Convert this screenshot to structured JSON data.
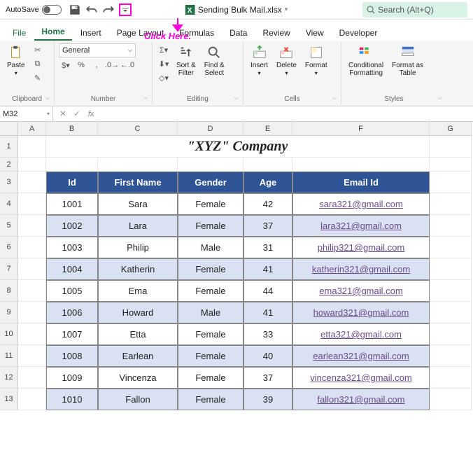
{
  "title": {
    "autosave": "AutoSave",
    "toggle": "Off",
    "filename": "Sending Bulk Mail.xlsx",
    "search": "Search (Alt+Q)"
  },
  "annotation": {
    "click": "Click Here."
  },
  "tabs": [
    "File",
    "Home",
    "Insert",
    "Page Layout",
    "Formulas",
    "Data",
    "Review",
    "View",
    "Developer"
  ],
  "ribbon": {
    "clipboard": "Clipboard",
    "paste": "Paste",
    "number": "Number",
    "numFormat": "General",
    "editing": "Editing",
    "sort": "Sort &\nFilter",
    "find": "Find &\nSelect",
    "cells": "Cells",
    "insert": "Insert",
    "delete": "Delete",
    "format": "Format",
    "styles": "Styles",
    "cond": "Conditional\nFormatting",
    "fmtTable": "Format as\nTable"
  },
  "fx": {
    "name": "M32"
  },
  "cols": [
    "A",
    "B",
    "C",
    "D",
    "E",
    "F",
    "G"
  ],
  "rows": [
    "1",
    "2",
    "3",
    "4",
    "5",
    "6",
    "7",
    "8",
    "9",
    "10",
    "11",
    "12",
    "13"
  ],
  "company": "\"XYZ\" Company",
  "headers": {
    "id": "Id",
    "fn": "First Name",
    "g": "Gender",
    "age": "Age",
    "email": "Email Id"
  },
  "data": [
    {
      "id": "1001",
      "fn": "Sara",
      "g": "Female",
      "age": "42",
      "email": "sara321@gmail.com"
    },
    {
      "id": "1002",
      "fn": "Lara",
      "g": "Female",
      "age": "37",
      "email": "lara321@gmail.com"
    },
    {
      "id": "1003",
      "fn": "Philip",
      "g": "Male",
      "age": "31",
      "email": "philip321@gmail.com"
    },
    {
      "id": "1004",
      "fn": "Katherin",
      "g": "Female",
      "age": "41",
      "email": "katherin321@gmail.com"
    },
    {
      "id": "1005",
      "fn": "Ema",
      "g": "Female",
      "age": "44",
      "email": "ema321@gmail.com"
    },
    {
      "id": "1006",
      "fn": "Howard",
      "g": "Male",
      "age": "41",
      "email": "howard321@gmail.com"
    },
    {
      "id": "1007",
      "fn": "Etta",
      "g": "Female",
      "age": "33",
      "email": "etta321@gmail.com"
    },
    {
      "id": "1008",
      "fn": "Earlean",
      "g": "Female",
      "age": "40",
      "email": "earlean321@gmail.com"
    },
    {
      "id": "1009",
      "fn": "Vincenza",
      "g": "Female",
      "age": "37",
      "email": "vincenza321@gmail.com"
    },
    {
      "id": "1010",
      "fn": "Fallon",
      "g": "Female",
      "age": "39",
      "email": "fallon321@gmail.com"
    }
  ]
}
